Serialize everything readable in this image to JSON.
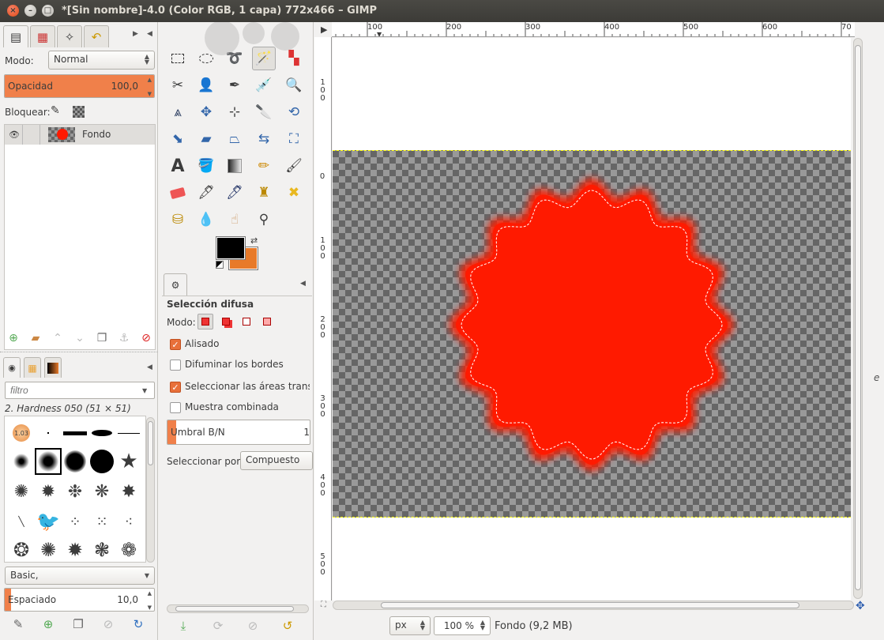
{
  "window": {
    "title": "*[Sin nombre]-4.0 (Color RGB, 1 capa) 772x466 – GIMP"
  },
  "layers_panel": {
    "mode_label": "Modo:",
    "mode_value": "Normal",
    "opacity_label": "Opacidad",
    "opacity_value": "100,0",
    "opacity_fraction": 1.0,
    "lock_label": "Bloquear:",
    "layers": [
      {
        "name": "Fondo"
      }
    ]
  },
  "brushes_panel": {
    "filter_placeholder": "filtro",
    "selected_brush": "2. Hardness 050 (51 × 51)",
    "preset_value": "Basic,",
    "spacing_label": "Espaciado",
    "spacing_value": "10,0",
    "spacing_fraction": 0.04,
    "scale_badge": "1.03"
  },
  "tool_options": {
    "title": "Selección difusa",
    "mode_label": "Modo:",
    "antialias_label": "Alisado",
    "antialias_checked": true,
    "feather_label": "Difuminar los bordes",
    "feather_checked": false,
    "transparent_label": "Seleccionar las áreas transpa",
    "transparent_checked": true,
    "merged_label": "Muestra combinada",
    "merged_checked": false,
    "threshold_label": "Umbral B/N",
    "threshold_value": "1",
    "threshold_fraction": 0.06,
    "select_by_label": "Seleccionar por:",
    "select_by_value": "Compuesto"
  },
  "rulers": {
    "h_labels": [
      "100",
      "200",
      "300",
      "400",
      "500",
      "600",
      "70"
    ],
    "v_labels": [
      "100",
      "0",
      "100",
      "200",
      "300",
      "400",
      "500"
    ]
  },
  "statusbar": {
    "unit": "px",
    "zoom": "100 %",
    "info": "Fondo (9,2 MB)"
  },
  "colors": {
    "foreground": "#000000",
    "background": "#e87a29",
    "shape_fill": "#ff1a00",
    "accent": "#f0804a"
  },
  "side_text": "e"
}
